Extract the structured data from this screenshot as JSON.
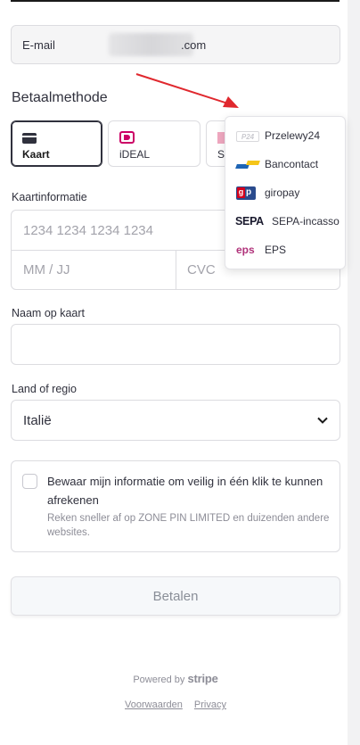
{
  "email": {
    "label": "E-mail",
    "value_suffix": ".com"
  },
  "payment_method": {
    "title": "Betaalmethode",
    "tabs": [
      {
        "label": "Kaart",
        "icon": "card-icon",
        "active": true
      },
      {
        "label": "iDEAL",
        "icon": "ideal-icon",
        "active": false
      },
      {
        "label": "S",
        "icon": "sepa-icon",
        "active": false
      }
    ],
    "dropdown": [
      {
        "label": "Przelewy24",
        "icon": "p24-icon",
        "icon_text": "P24"
      },
      {
        "label": "Bancontact",
        "icon": "bancontact-icon"
      },
      {
        "label": "giropay",
        "icon": "giropay-icon"
      },
      {
        "label": "SEPA-incasso",
        "icon": "sepa-icon",
        "icon_text": "SEPA"
      },
      {
        "label": "EPS",
        "icon": "eps-icon",
        "icon_text": "eps"
      }
    ]
  },
  "card_info": {
    "label": "Kaartinformatie",
    "number_placeholder": "1234 1234 1234 1234",
    "expiry_placeholder": "MM / JJ",
    "cvc_placeholder": "CVC"
  },
  "cardholder": {
    "label": "Naam op kaart",
    "value": ""
  },
  "country": {
    "label": "Land of regio",
    "selected": "Italië"
  },
  "save_info": {
    "checked": false,
    "title": "Bewaar mijn informatie om veilig in één klik te kunnen afrekenen",
    "subtitle": "Reken sneller af op ZONE PIN LIMITED en duizenden andere websites."
  },
  "pay_button": {
    "label": "Betalen"
  },
  "footer": {
    "powered_prefix": "Powered by",
    "powered_brand": "stripe",
    "terms": "Voorwaarden",
    "privacy": "Privacy"
  },
  "colors": {
    "accent_arrow": "#e0282e",
    "border": "#dcdce0",
    "text": "#30313d"
  }
}
